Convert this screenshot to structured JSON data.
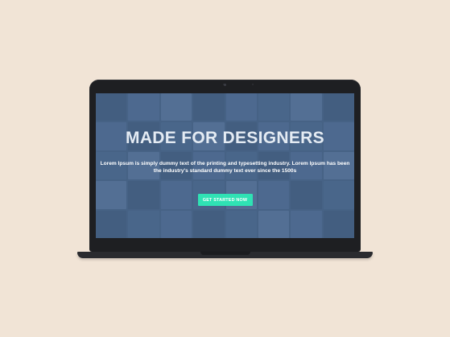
{
  "hero": {
    "title": "MADE FOR DESIGNERS",
    "description": "Lorem Ipsum is simply dummy text of the printing and typesetting industry. Lorem Ipsum has been the industry's standard dummy text ever since the 1500s",
    "cta_label": "GET STARTED NOW"
  },
  "colors": {
    "background": "#f1e4d6",
    "laptop": "#1e1f22",
    "screen_overlay": "#4a6587",
    "cta": "#2fe2b4"
  }
}
